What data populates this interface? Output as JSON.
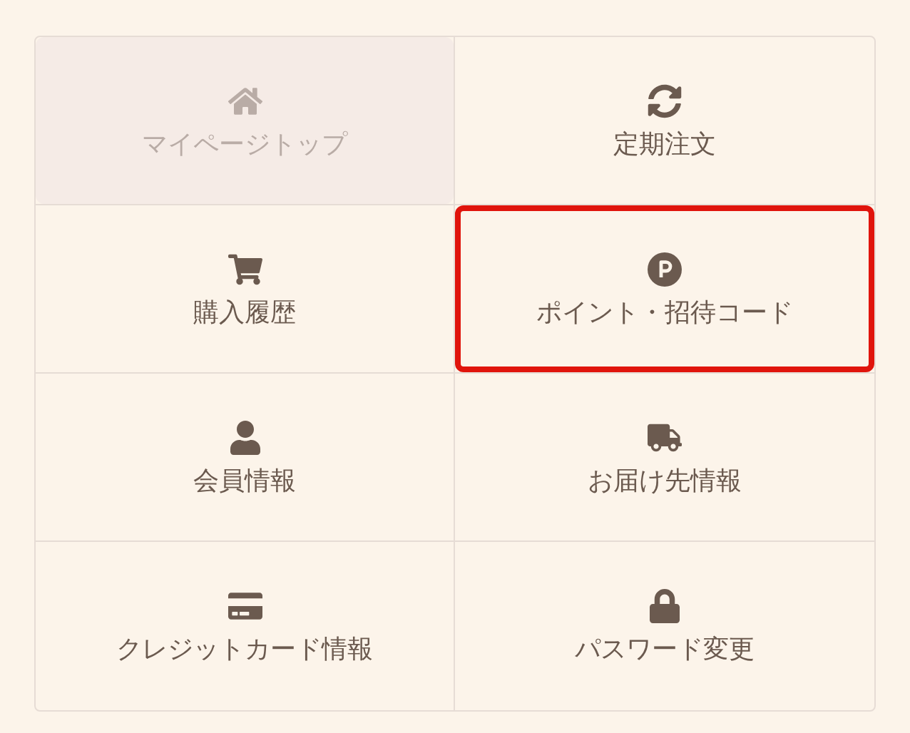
{
  "menu": [
    {
      "label": "マイページトップ",
      "selected": true,
      "highlighted": false
    },
    {
      "label": "定期注文",
      "selected": false,
      "highlighted": false
    },
    {
      "label": "購入履歴",
      "selected": false,
      "highlighted": false
    },
    {
      "label": "ポイント・招待コード",
      "selected": false,
      "highlighted": true
    },
    {
      "label": "会員情報",
      "selected": false,
      "highlighted": false
    },
    {
      "label": "お届け先情報",
      "selected": false,
      "highlighted": false
    },
    {
      "label": "クレジットカード情報",
      "selected": false,
      "highlighted": false
    },
    {
      "label": "パスワード変更",
      "selected": false,
      "highlighted": false
    }
  ]
}
